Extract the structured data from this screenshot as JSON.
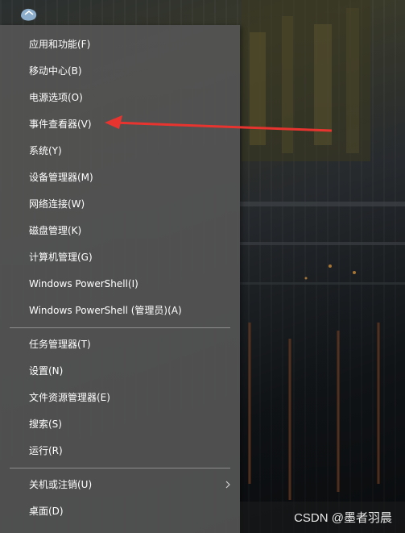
{
  "menu": {
    "group1": [
      {
        "label": "应用和功能(F)"
      },
      {
        "label": "移动中心(B)"
      },
      {
        "label": "电源选项(O)"
      },
      {
        "label": "事件查看器(V)"
      },
      {
        "label": "系统(Y)"
      },
      {
        "label": "设备管理器(M)"
      },
      {
        "label": "网络连接(W)"
      },
      {
        "label": "磁盘管理(K)"
      },
      {
        "label": "计算机管理(G)"
      },
      {
        "label": "Windows PowerShell(I)"
      },
      {
        "label": "Windows PowerShell (管理员)(A)"
      }
    ],
    "group2": [
      {
        "label": "任务管理器(T)"
      },
      {
        "label": "设置(N)"
      },
      {
        "label": "文件资源管理器(E)"
      },
      {
        "label": "搜索(S)"
      },
      {
        "label": "运行(R)"
      }
    ],
    "group3": [
      {
        "label": "关机或注销(U)",
        "submenu_icon": "chevron-right-icon"
      },
      {
        "label": "桌面(D)"
      }
    ]
  },
  "annotation": {
    "arrow_color": "#e8342f"
  },
  "watermark": {
    "text": "CSDN @墨者羽晨"
  },
  "colors": {
    "menu_bg": "#545454",
    "menu_text": "#ffffff",
    "separator": "#8d8d8d"
  }
}
